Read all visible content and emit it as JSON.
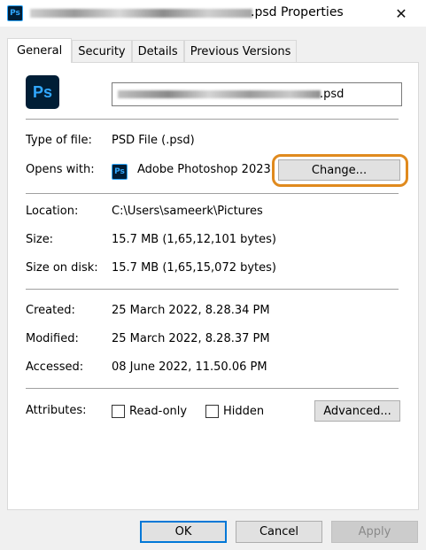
{
  "window": {
    "title_suffix": ".psd Properties",
    "app_icon_text": "Ps",
    "close_glyph": "✕"
  },
  "tabs": [
    {
      "label": "General",
      "active": true
    },
    {
      "label": "Security",
      "active": false
    },
    {
      "label": "Details",
      "active": false
    },
    {
      "label": "Previous Versions",
      "active": false
    }
  ],
  "general": {
    "file_icon_text": "Ps",
    "file_name_suffix": ".psd",
    "type_label": "Type of file:",
    "type_value": "PSD File (.psd)",
    "opens_label": "Opens with:",
    "opens_icon_text": "Ps",
    "opens_value": "Adobe Photoshop 2023",
    "change_button": "Change...",
    "location_label": "Location:",
    "location_value": "C:\\Users\\sameerk\\Pictures",
    "size_label": "Size:",
    "size_value": "15.7 MB (1,65,12,101 bytes)",
    "size_disk_label": "Size on disk:",
    "size_disk_value": "15.7 MB (1,65,15,072 bytes)",
    "created_label": "Created:",
    "created_value": "25 March 2022, 8.28.34 PM",
    "modified_label": "Modified:",
    "modified_value": "25 March 2022, 8.28.37 PM",
    "accessed_label": "Accessed:",
    "accessed_value": "08 June 2022, 11.50.06 PM",
    "attributes_label": "Attributes:",
    "readonly_label": "Read-only",
    "hidden_label": "Hidden",
    "advanced_button": "Advanced..."
  },
  "footer": {
    "ok": "OK",
    "cancel": "Cancel",
    "apply": "Apply"
  },
  "colors": {
    "photoshop_bg": "#001e36",
    "photoshop_fg": "#31a8ff",
    "highlight": "#e08a1e",
    "focus": "#0078d7"
  }
}
